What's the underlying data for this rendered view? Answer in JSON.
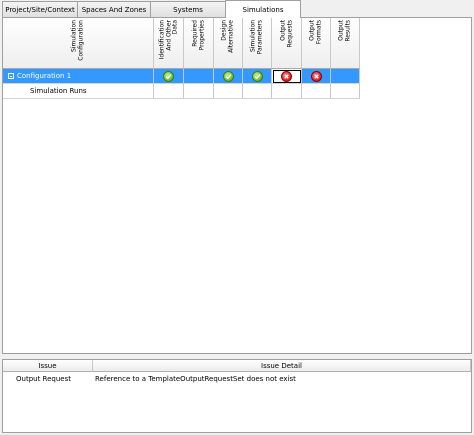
{
  "tabs": [
    {
      "label": "Project/Site/Context"
    },
    {
      "label": "Spaces And Zones"
    },
    {
      "label": "Systems"
    },
    {
      "label": "Simulations",
      "active": true
    }
  ],
  "grid": {
    "columns": [
      {
        "label": "Simulation\nConfiguration"
      },
      {
        "label": "Identification\nAnd Other\nData"
      },
      {
        "label": "Required\nProperties"
      },
      {
        "label": "Design\nAlternative"
      },
      {
        "label": "Simulation\nParameters"
      },
      {
        "label": "Output\nRequests"
      },
      {
        "label": "Output\nFormats"
      },
      {
        "label": "Output\nResults"
      }
    ],
    "rows": [
      {
        "name": "Configuration 1",
        "statuses": [
          "check",
          "",
          "check",
          "check",
          "error",
          "error",
          ""
        ]
      },
      {
        "name": "Simulation Runs"
      }
    ]
  },
  "issues": {
    "columns": {
      "issue": "Issue",
      "detail": "Issue Detail"
    },
    "rows": [
      {
        "issue": "Output Request",
        "detail": "Reference to a TemplateOutputRequestSet does not exist"
      }
    ]
  },
  "colors": {
    "selection": "#3399ff",
    "ok": "#4aa01a",
    "error": "#c40000"
  }
}
